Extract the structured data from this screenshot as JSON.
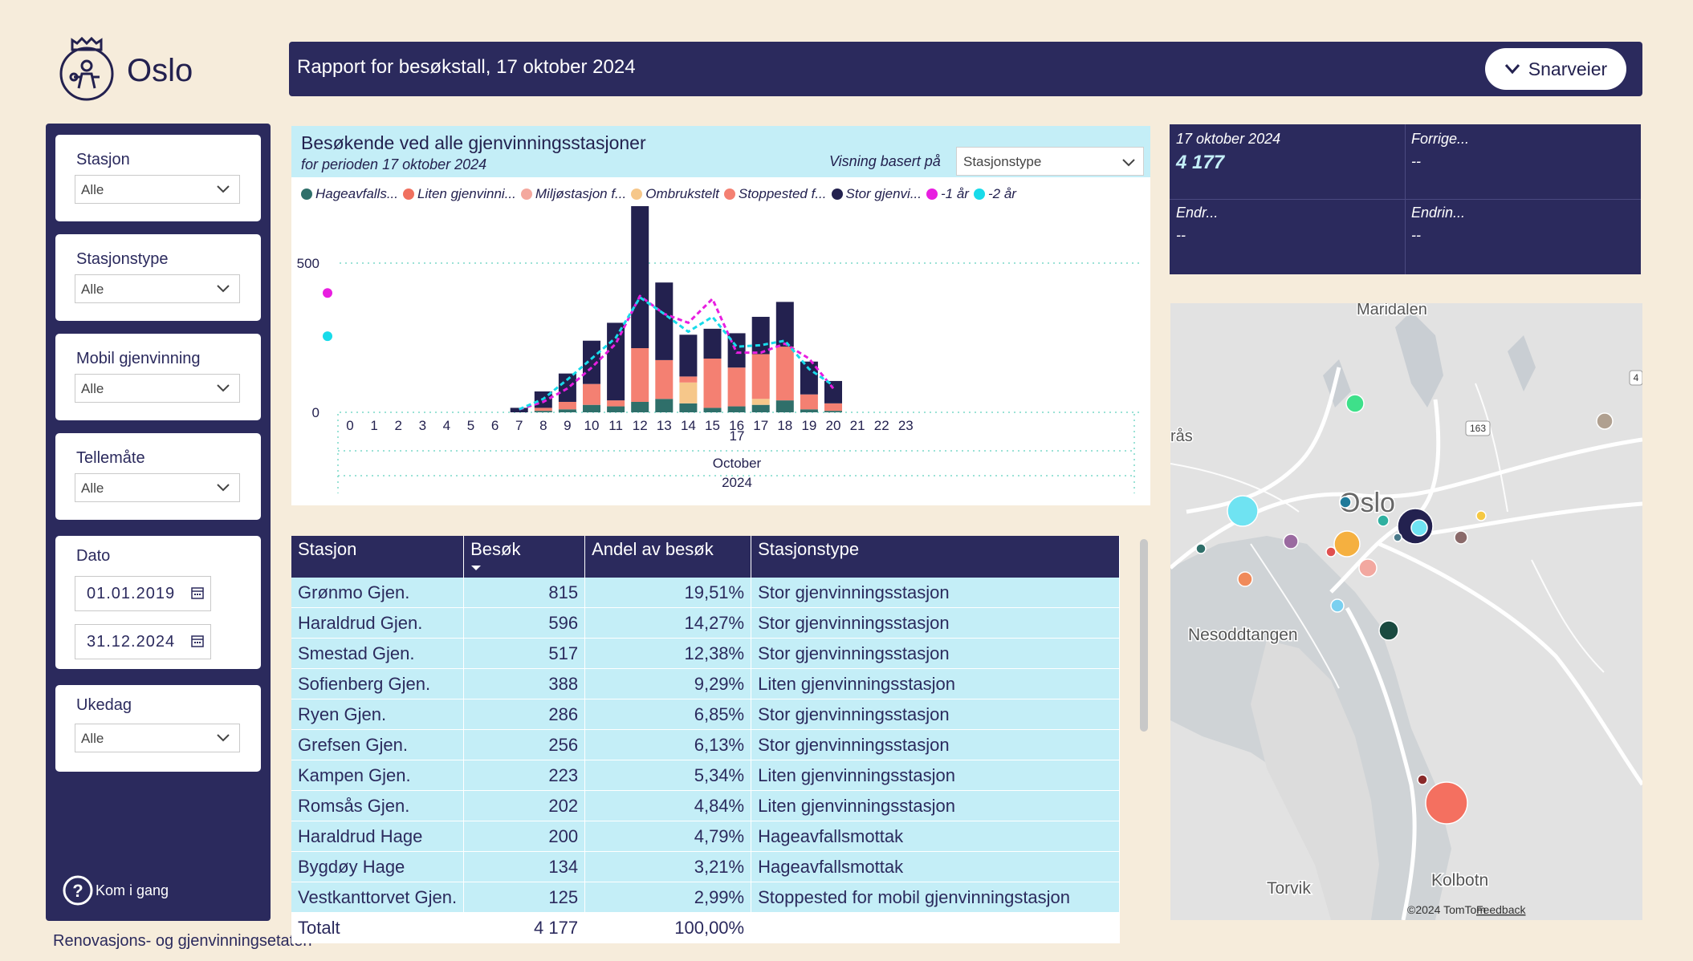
{
  "app": {
    "logo_text": "Oslo",
    "agency": "Renovasjons- og gjenvinningsetaten"
  },
  "header": {
    "title": "Rapport for besøkstall, 17 oktober 2024",
    "shortcut_label": "Snarveier"
  },
  "sidebar": {
    "slicers": [
      {
        "label": "Stasjon",
        "value": "Alle"
      },
      {
        "label": "Stasjonstype",
        "value": "Alle"
      },
      {
        "label": "Mobil gjenvinning",
        "value": "Alle"
      },
      {
        "label": "Tellemåte",
        "value": "Alle"
      }
    ],
    "date": {
      "label": "Dato",
      "from": "01.01.2019",
      "to": "31.12.2024"
    },
    "weekday": {
      "label": "Ukedag",
      "value": "Alle"
    },
    "help_label": "Kom i gang"
  },
  "kpi": {
    "date_label": "17 oktober 2024",
    "value": "4 177",
    "prev_label": "Forrige...",
    "prev_value": "--",
    "change_label": "Endr...",
    "change_value": "--",
    "change_pct_label": "Endrin...",
    "change_pct_value": "--"
  },
  "chart_card": {
    "title": "Besøkende ved alle gjenvinningsstasjoner",
    "subtitle": "for perioden 17 oktober 2024",
    "view_label": "Visning basert på",
    "view_value": "Stasjonstype"
  },
  "chart_data": {
    "type": "bar",
    "stacked": true,
    "categories": [
      "0",
      "1",
      "2",
      "3",
      "4",
      "5",
      "6",
      "7",
      "8",
      "9",
      "10",
      "11",
      "12",
      "13",
      "14",
      "15",
      "16",
      "17",
      "18",
      "19",
      "20",
      "21",
      "22",
      "23"
    ],
    "x_sub_labels": [
      "17",
      "October",
      "2024"
    ],
    "ylim": [
      0,
      600
    ],
    "yticks": [
      0,
      500
    ],
    "grid": true,
    "legend_position": "top-left",
    "series": [
      {
        "name": "Hageavfalls...",
        "color": "#2f6f6a",
        "values": [
          0,
          0,
          0,
          0,
          0,
          0,
          0,
          0,
          5,
          10,
          25,
          20,
          35,
          45,
          30,
          15,
          20,
          25,
          40,
          10,
          5,
          0,
          0,
          0
        ]
      },
      {
        "name": "Liten gjenvinni...",
        "color": "#f0705f",
        "values": [
          0,
          0,
          0,
          0,
          0,
          0,
          0,
          0,
          0,
          0,
          0,
          0,
          0,
          0,
          0,
          0,
          0,
          0,
          0,
          0,
          0,
          0,
          0,
          0
        ]
      },
      {
        "name": "Miljøstasjon f...",
        "color": "#f4a89e",
        "values": [
          0,
          0,
          0,
          0,
          0,
          0,
          0,
          0,
          0,
          0,
          0,
          0,
          0,
          0,
          0,
          0,
          0,
          0,
          0,
          0,
          0,
          0,
          0,
          0
        ]
      },
      {
        "name": "Ombrukstelt",
        "color": "#f6c78a",
        "values": [
          0,
          0,
          0,
          0,
          0,
          0,
          0,
          0,
          0,
          0,
          0,
          0,
          0,
          0,
          70,
          0,
          0,
          20,
          0,
          0,
          0,
          0,
          0,
          0
        ]
      },
      {
        "name": "Stoppested f...",
        "color": "#f48072",
        "values": [
          0,
          0,
          0,
          0,
          0,
          0,
          0,
          0,
          10,
          25,
          70,
          20,
          180,
          130,
          20,
          165,
          130,
          150,
          180,
          50,
          25,
          0,
          0,
          0
        ]
      },
      {
        "name": "Stor gjenvi...",
        "color": "#23214f",
        "values": [
          0,
          0,
          0,
          0,
          0,
          0,
          0,
          15,
          55,
          95,
          145,
          260,
          485,
          260,
          140,
          100,
          115,
          125,
          150,
          110,
          75,
          0,
          0,
          0
        ]
      }
    ],
    "lines": [
      {
        "name": "-1 år",
        "color": "#e81ee0",
        "dashed": true,
        "values": [
          400,
          null,
          null,
          null,
          null,
          null,
          null,
          10,
          35,
          80,
          150,
          230,
          390,
          330,
          300,
          380,
          200,
          200,
          230,
          180,
          80,
          null,
          null,
          null
        ]
      },
      {
        "name": "-2 år",
        "color": "#18dbea",
        "dashed": true,
        "values": [
          255,
          null,
          null,
          null,
          null,
          null,
          null,
          10,
          45,
          110,
          180,
          250,
          385,
          330,
          270,
          320,
          220,
          225,
          240,
          145,
          90,
          null,
          null,
          null
        ]
      }
    ]
  },
  "table": {
    "headers": [
      "Stasjon",
      "Besøk",
      "Andel av besøk",
      "Stasjonstype"
    ],
    "rows": [
      [
        "Grønmo Gjen.",
        "815",
        "19,51%",
        "Stor gjenvinningsstasjon"
      ],
      [
        "Haraldrud Gjen.",
        "596",
        "14,27%",
        "Stor gjenvinningsstasjon"
      ],
      [
        "Smestad Gjen.",
        "517",
        "12,38%",
        "Stor gjenvinningsstasjon"
      ],
      [
        "Sofienberg Gjen.",
        "388",
        "9,29%",
        "Liten gjenvinningsstasjon"
      ],
      [
        "Ryen Gjen.",
        "286",
        "6,85%",
        "Stor gjenvinningsstasjon"
      ],
      [
        "Grefsen Gjen.",
        "256",
        "6,13%",
        "Stor gjenvinningsstasjon"
      ],
      [
        "Kampen Gjen.",
        "223",
        "5,34%",
        "Liten gjenvinningsstasjon"
      ],
      [
        "Romsås Gjen.",
        "202",
        "4,84%",
        "Liten gjenvinningsstasjon"
      ],
      [
        "Haraldrud Hage",
        "200",
        "4,79%",
        "Hageavfallsmottak"
      ],
      [
        "Bygdøy Hage",
        "134",
        "3,21%",
        "Hageavfallsmottak"
      ],
      [
        "Vestkanttorvet Gjen.",
        "125",
        "2,99%",
        "Stoppested for mobil gjenvinningstasjon"
      ]
    ],
    "total": [
      "Totalt",
      "4 177",
      "100,00%",
      ""
    ]
  },
  "map": {
    "labels": {
      "maridalen": "Maridalen",
      "oslo": "Oslo",
      "nesoddtangen": "Nesoddtangen",
      "torvik": "Torvik",
      "kolbotn": "Kolbotn",
      "ras": "rås"
    },
    "road_badges": [
      "163",
      "4"
    ],
    "attribution": "©2024 TomTom",
    "feedback": "Feedback"
  }
}
